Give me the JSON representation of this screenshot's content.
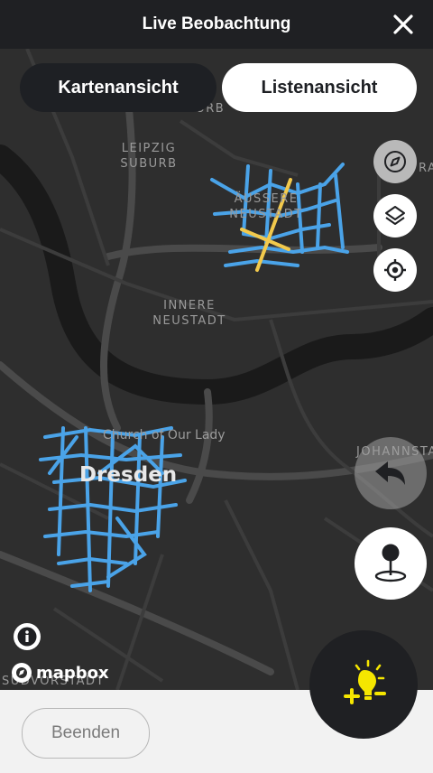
{
  "header": {
    "title": "Live Beobachtung"
  },
  "tabs": {
    "map": "Kartenansicht",
    "list": "Listenansicht"
  },
  "map": {
    "labels": {
      "suburb_top": "SUBURB",
      "leipzig": "LEIPZIG",
      "suburb": "SUBURB",
      "aussere": "ÄUSSERE",
      "neustadt1": "NEUSTADT",
      "innere": "INNERE",
      "neustadt2": "NEUSTADT",
      "church": "Church of Our Lady",
      "dresden": "Dresden",
      "johannstadt": "JOHANNSTA",
      "sudvorstadt": "SÜDVORSTADT",
      "ra": "RA"
    },
    "attribution": "mapbox"
  },
  "footer": {
    "end_label": "Beenden"
  },
  "colors": {
    "route_blue": "#4aa3e8",
    "route_yellow": "#f2c94c",
    "accent": "#f5e600"
  }
}
